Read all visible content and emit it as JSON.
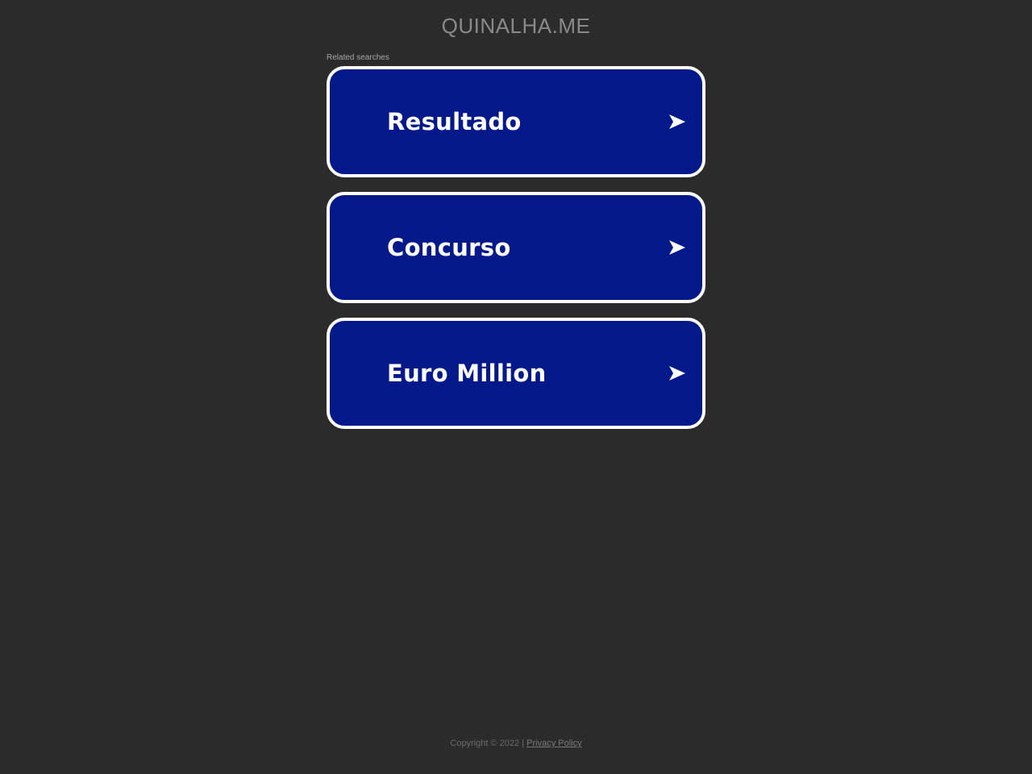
{
  "header": {
    "domain": "QUINALHA.ME"
  },
  "related": {
    "label": "Related searches",
    "items": [
      {
        "label": "Resultado",
        "icon": "arrow-right-icon"
      },
      {
        "label": "Concurso",
        "icon": "arrow-right-icon"
      },
      {
        "label": "Euro Million",
        "icon": "arrow-right-icon"
      }
    ]
  },
  "footer": {
    "copyright": "Copyright © 2022 | ",
    "privacy_label": "Privacy Policy"
  },
  "colors": {
    "background": "#2b2b2b",
    "button_fill": "#03198a",
    "button_border": "#ffffff"
  }
}
